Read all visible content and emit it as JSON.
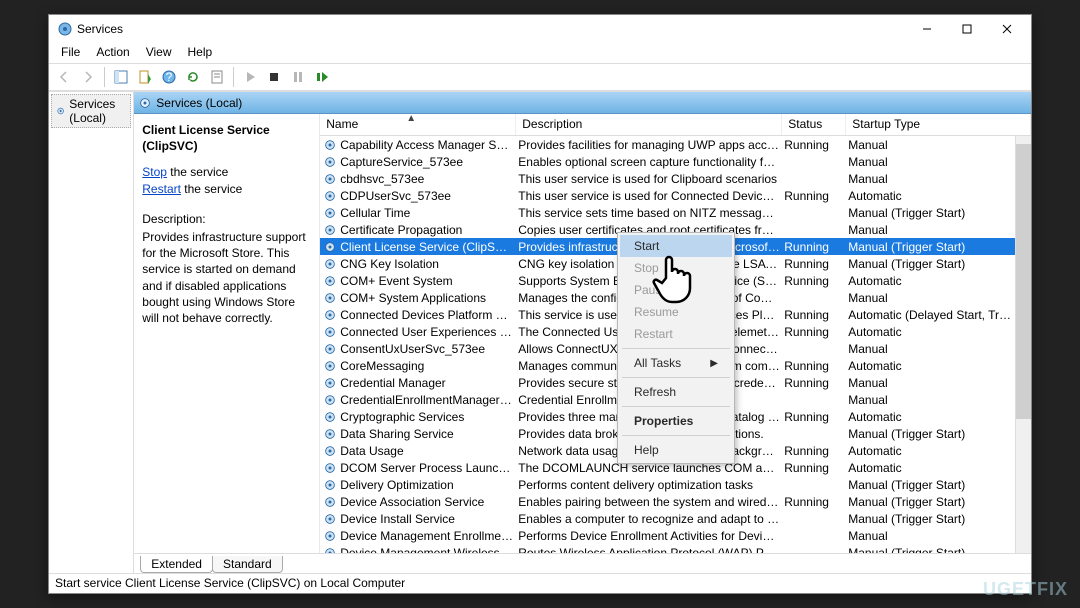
{
  "window": {
    "title": "Services"
  },
  "menus": {
    "file": "File",
    "action": "Action",
    "view": "View",
    "help": "Help"
  },
  "tree": {
    "node": "Services (Local)"
  },
  "header": {
    "label": "Services (Local)"
  },
  "detail": {
    "title": "Client License Service (ClipSVC)",
    "stop_link": "Stop",
    "stop_rest": " the service",
    "restart_link": "Restart",
    "restart_rest": " the service",
    "desc_h": "Description:",
    "desc": "Provides infrastructure support for the Microsoft Store. This service is started on demand and if disabled applications bought using Windows Store will not behave correctly."
  },
  "columns": {
    "name": "Name",
    "desc": "Description",
    "status": "Status",
    "startup": "Startup Type"
  },
  "services": [
    {
      "name": "Capability Access Manager Service",
      "desc": "Provides facilities for managing UWP apps access to app …",
      "status": "Running",
      "startup": "Manual"
    },
    {
      "name": "CaptureService_573ee",
      "desc": "Enables optional screen capture functionality for applicati…",
      "status": "",
      "startup": "Manual"
    },
    {
      "name": "cbdhsvc_573ee",
      "desc": "This user service is used for Clipboard scenarios",
      "status": "",
      "startup": "Manual"
    },
    {
      "name": "CDPUserSvc_573ee",
      "desc": "This user service is used for Connected Devices Platform s…",
      "status": "Running",
      "startup": "Automatic"
    },
    {
      "name": "Cellular Time",
      "desc": "This service sets time based on NITZ messages from a Mo…",
      "status": "",
      "startup": "Manual (Trigger Start)"
    },
    {
      "name": "Certificate Propagation",
      "desc": "Copies user certificates and root certificates from smart c…",
      "status": "",
      "startup": "Manual"
    },
    {
      "name": "Client License Service (ClipSVC)",
      "desc": "Provides infrastructure support for the Microsoft Store. T…",
      "status": "Running",
      "startup": "Manual (Trigger Start)",
      "selected": true
    },
    {
      "name": "CNG Key Isolation",
      "desc": "CNG key isolation service is hosted in the LSA proces…",
      "status": "Running",
      "startup": "Manual (Trigger Start)"
    },
    {
      "name": "COM+ Event System",
      "desc": "Supports System Event Notification Service (SENS), which…",
      "status": "Running",
      "startup": "Automatic"
    },
    {
      "name": "COM+ System Applications",
      "desc": "Manages the configuration and tracking of Component …",
      "status": "",
      "startup": "Manual"
    },
    {
      "name": "Connected Devices Platform Service",
      "desc": "This service is used for Connected Devices Platform scena…",
      "status": "Running",
      "startup": "Automatic (Delayed Start, Tr…"
    },
    {
      "name": "Connected User Experiences and Telemetry",
      "desc": "The Connected User Experiences and Telemetry service en…",
      "status": "Running",
      "startup": "Automatic"
    },
    {
      "name": "ConsentUxUserSvc_573ee",
      "desc": "Allows ConnectUX and PC Settings to Connect and Pair …",
      "status": "",
      "startup": "Manual"
    },
    {
      "name": "CoreMessaging",
      "desc": "Manages communication between system components.",
      "status": "Running",
      "startup": "Automatic"
    },
    {
      "name": "Credential Manager",
      "desc": "Provides secure storage and retrieval of credentials to use…",
      "status": "Running",
      "startup": "Manual"
    },
    {
      "name": "CredentialEnrollmentManagerUserSvc",
      "desc": "Credential Enrollment Manager",
      "status": "",
      "startup": "Manual"
    },
    {
      "name": "Cryptographic Services",
      "desc": "Provides three management services: Catalog Database S…",
      "status": "Running",
      "startup": "Automatic"
    },
    {
      "name": "Data Sharing Service",
      "desc": "Provides data brokering between applications.",
      "status": "",
      "startup": "Manual (Trigger Start)"
    },
    {
      "name": "Data Usage",
      "desc": "Network data usage, data limit, restrict background data, …",
      "status": "Running",
      "startup": "Automatic"
    },
    {
      "name": "DCOM Server Process Launcher",
      "desc": "The DCOMLAUNCH service launches COM and DCOM se…",
      "status": "Running",
      "startup": "Automatic"
    },
    {
      "name": "Delivery Optimization",
      "desc": "Performs content delivery optimization tasks",
      "status": "",
      "startup": "Manual (Trigger Start)"
    },
    {
      "name": "Device Association Service",
      "desc": "Enables pairing between the system and wired or wireless…",
      "status": "Running",
      "startup": "Manual (Trigger Start)"
    },
    {
      "name": "Device Install Service",
      "desc": "Enables a computer to recognize and adapt to hardware c…",
      "status": "",
      "startup": "Manual (Trigger Start)"
    },
    {
      "name": "Device Management Enrollment Service",
      "desc": "Performs Device Enrollment Activities for Device Manage…",
      "status": "",
      "startup": "Manual"
    },
    {
      "name": "Device Management Wireless Application",
      "desc": "Routes Wireless Application Protocol (WAP) Push messag…",
      "status": "",
      "startup": "Manual (Trigger Start)"
    }
  ],
  "context": {
    "start": "Start",
    "stop": "Stop",
    "pause": "Pause",
    "resume": "Resume",
    "restart": "Restart",
    "alltasks": "All Tasks",
    "refresh": "Refresh",
    "properties": "Properties",
    "help": "Help"
  },
  "tabs": {
    "extended": "Extended",
    "standard": "Standard"
  },
  "statusbar": "Start service Client License Service (ClipSVC) on Local Computer",
  "watermark": "UGETFIX"
}
